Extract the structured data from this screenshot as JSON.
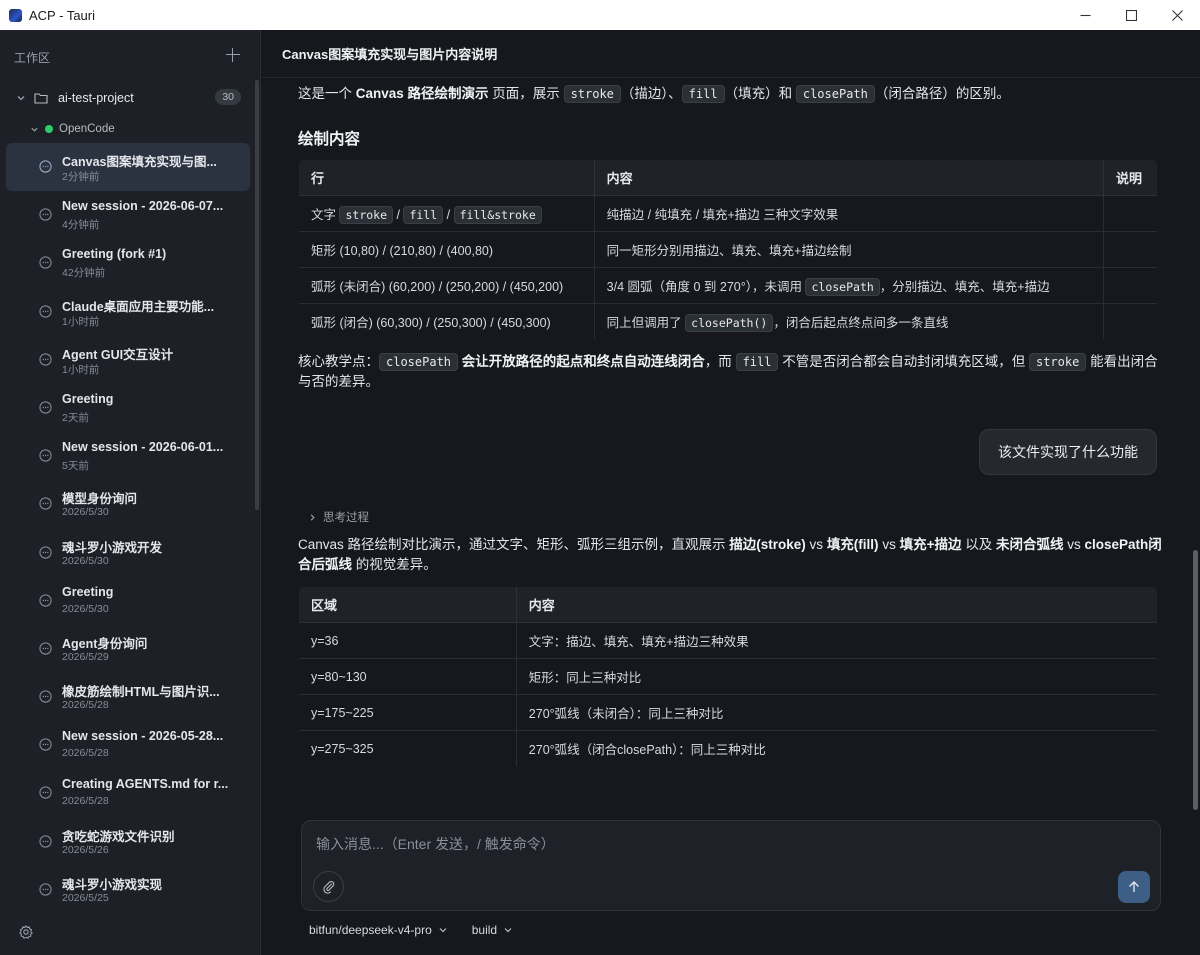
{
  "window": {
    "title": "ACP - Tauri"
  },
  "sidebar": {
    "workspace_label": "工作区",
    "project": {
      "name": "ai-test-project",
      "count": "30"
    },
    "agent": {
      "name": "OpenCode"
    },
    "sessions": [
      {
        "title": "Canvas图案填充实现与图...",
        "time": "2分钟前",
        "active": true
      },
      {
        "title": "New session - 2026-06-07...",
        "time": "4分钟前"
      },
      {
        "title": "Greeting (fork #1)",
        "time": "42分钟前"
      },
      {
        "title": "Claude桌面应用主要功能...",
        "time": "1小时前"
      },
      {
        "title": "Agent GUI交互设计",
        "time": "1小时前"
      },
      {
        "title": "Greeting",
        "time": "2天前"
      },
      {
        "title": "New session - 2026-06-01...",
        "time": "5天前"
      },
      {
        "title": "模型身份询问",
        "time": "2026/5/30"
      },
      {
        "title": "魂斗罗小游戏开发",
        "time": "2026/5/30"
      },
      {
        "title": "Greeting",
        "time": "2026/5/30"
      },
      {
        "title": "Agent身份询问",
        "time": "2026/5/29"
      },
      {
        "title": "橡皮筋绘制HTML与图片识...",
        "time": "2026/5/28"
      },
      {
        "title": "New session - 2026-05-28...",
        "time": "2026/5/28"
      },
      {
        "title": "Creating AGENTS.md for r...",
        "time": "2026/5/28"
      },
      {
        "title": "贪吃蛇游戏文件识别",
        "time": "2026/5/26"
      },
      {
        "title": "魂斗罗小游戏实现",
        "time": "2026/5/25"
      }
    ]
  },
  "main": {
    "title": "Canvas图案填充实现与图片内容说明",
    "intro": {
      "p1": "这是一个 ",
      "b1": "Canvas 路径绘制演示",
      "p2": " 页面，展示 ",
      "c1": "stroke",
      "p3": "（描边）、",
      "c2": "fill",
      "p4": "（填充）和 ",
      "c3": "closePath",
      "p5": "（闭合路径）的区别。"
    },
    "section_heading": "绘制内容",
    "table1": {
      "headers": [
        "行",
        "内容",
        "说明"
      ],
      "rows": [
        {
          "c1_prefix": "文字 ",
          "c1_codes": [
            "stroke",
            "fill",
            "fill&stroke"
          ],
          "c1_sep": " / ",
          "c2": "纯描边 / 纯填充 / 填充+描边 三种文字效果",
          "c3": ""
        },
        {
          "c1": "矩形 (10,80) / (210,80) / (400,80)",
          "c2": "同一矩形分别用描边、填充、填充+描边绘制",
          "c3": ""
        },
        {
          "c1": "弧形 (未闭合) (60,200) / (250,200) / (450,200)",
          "c2_pre": "3/4 圆弧（角度 0 到 270°），未调用 ",
          "c2_code": "closePath",
          "c2_post": "，分别描边、填充、填充+描边",
          "c3": ""
        },
        {
          "c1": "弧形 (闭合) (60,300) / (250,300) / (450,300)",
          "c2_pre": "同上但调用了 ",
          "c2_code": "closePath()",
          "c2_post": "，闭合后起点终点间多一条直线",
          "c3": ""
        }
      ]
    },
    "core": {
      "p1": "核心教学点：",
      "c1": "closePath",
      "b1": " 会让开放路径的起点和终点自动连线闭合",
      "p2": "，而 ",
      "c2": "fill",
      "p3": " 不管是否闭合都会自动封闭填充区域，但 ",
      "c3": "stroke",
      "p4": " 能看出闭合与否的差异。"
    },
    "user_message": "该文件实现了什么功能",
    "thinking_label": "思考过程",
    "answer": {
      "p1": "Canvas 路径绘制对比演示，通过文字、矩形、弧形三组示例，直观展示 ",
      "b1": "描边(stroke)",
      "p2": " vs ",
      "b2": "填充(fill)",
      "p3": " vs ",
      "b3": "填充+描边",
      "p4": " 以及 ",
      "b4": "未闭合弧线",
      "p5": " vs ",
      "b5": "closePath闭合后弧线",
      "p6": " 的视觉差异。"
    },
    "table2": {
      "headers": [
        "区域",
        "内容"
      ],
      "rows": [
        [
          "y=36",
          "文字：描边、填充、填充+描边三种效果"
        ],
        [
          "y=80~130",
          "矩形：同上三种对比"
        ],
        [
          "y=175~225",
          "270°弧线（未闭合）：同上三种对比"
        ],
        [
          "y=275~325",
          "270°弧线（闭合closePath）：同上三种对比"
        ]
      ]
    }
  },
  "composer": {
    "placeholder": "输入消息...（Enter 发送，/ 触发命令）",
    "model": "bitfun/deepseek-v4-pro",
    "mode": "build"
  },
  "colors": {
    "accent_send": "#3d5f86",
    "status_online": "#2fcb6a",
    "active_session_bg": "#2c3340"
  }
}
